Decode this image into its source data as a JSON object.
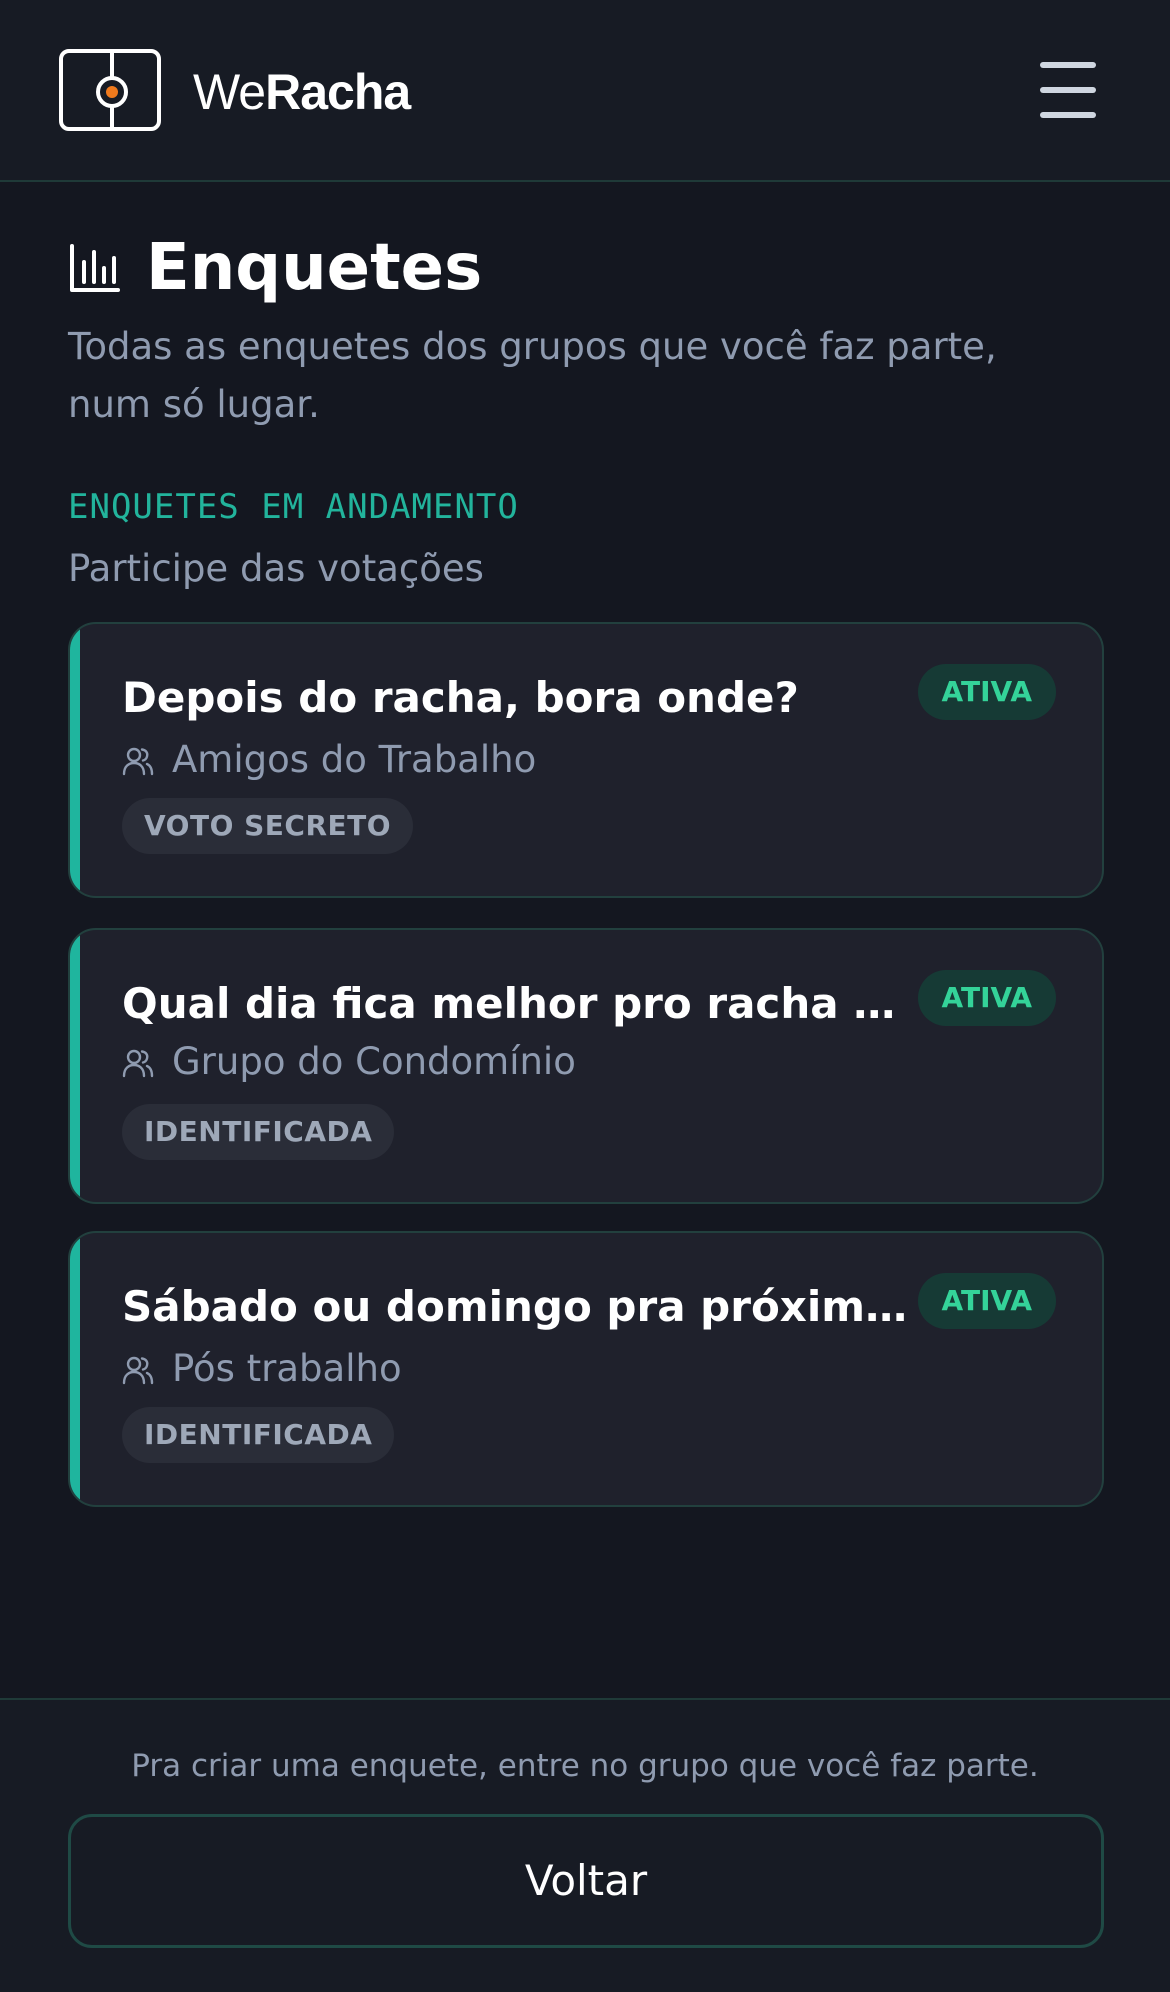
{
  "header": {
    "brand_prefix": "We",
    "brand_bold": "Racha",
    "logo_icon": "soccer-field-icon",
    "menu_icon": "hamburger-menu-icon"
  },
  "page": {
    "title": "Enquetes",
    "title_icon": "bar-chart-icon",
    "subtitle": "Todas as enquetes dos grupos que você faz parte, num só lugar."
  },
  "section": {
    "label": "ENQUETES EM ANDAMENTO",
    "sub": "Participe das votações"
  },
  "polls": [
    {
      "title": "Depois do racha, bora onde?",
      "status": "ATIVA",
      "group": "Amigos do Trabalho",
      "type": "VOTO SECRETO"
    },
    {
      "title": "Qual dia fica melhor pro racha do c...",
      "status": "ATIVA",
      "group": "Grupo do Condomínio",
      "type": "IDENTIFICADA"
    },
    {
      "title": "Sábado ou domingo pra próxima p...",
      "status": "ATIVA",
      "group": "Pós trabalho",
      "type": "IDENTIFICADA"
    }
  ],
  "footer": {
    "note": "Pra criar uma enquete, entre no grupo que você faz parte.",
    "back_label": "Voltar"
  },
  "colors": {
    "accent": "#1fb59e",
    "background": "#141720",
    "logo_dot": "#f07a1d",
    "active_badge_text": "#34d399"
  }
}
